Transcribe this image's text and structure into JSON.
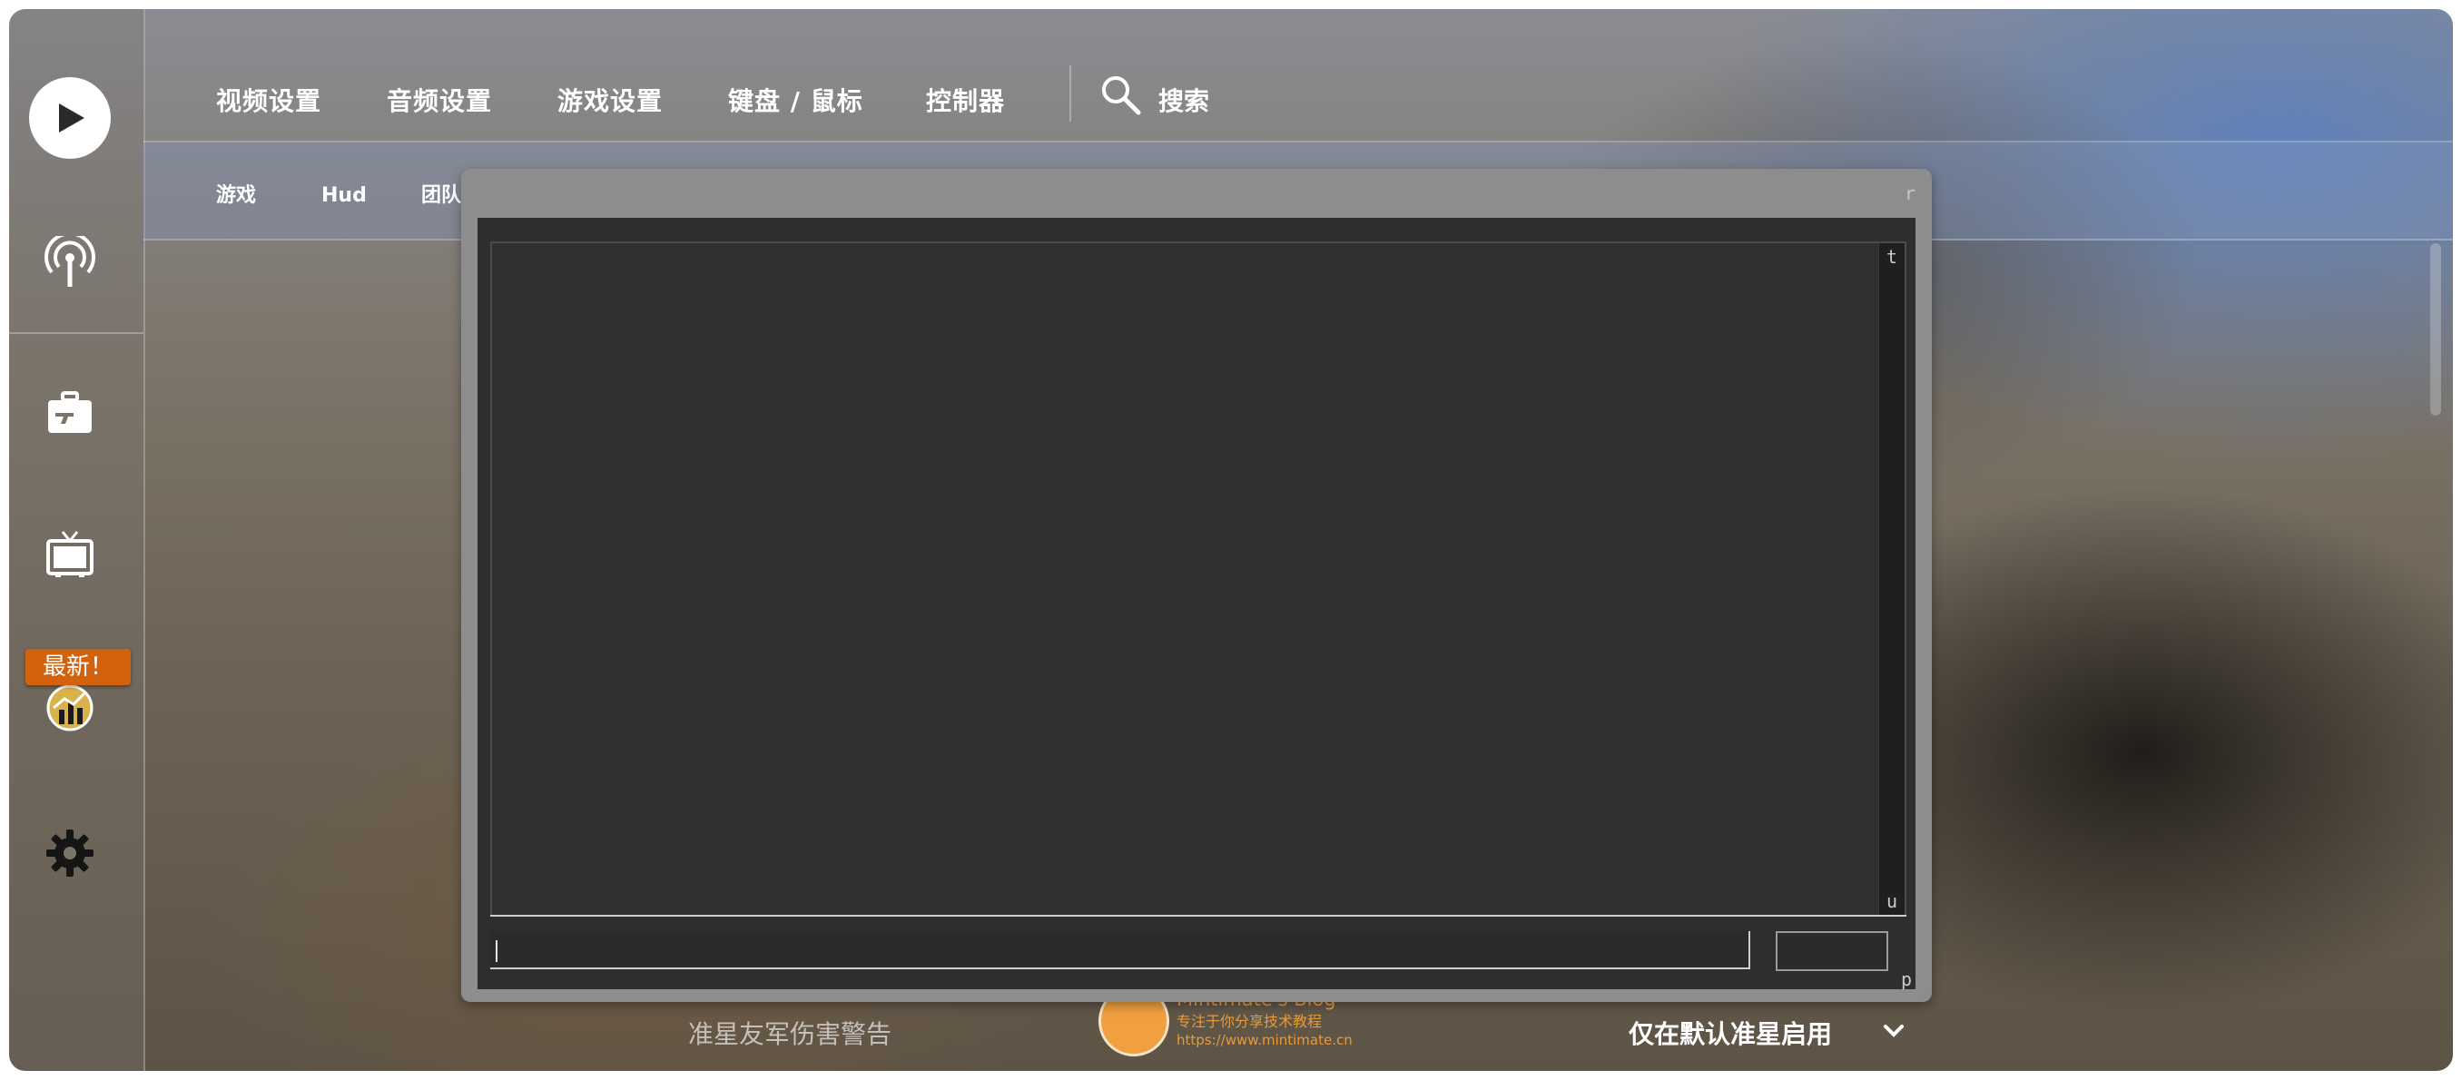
{
  "topnav": {
    "tabs": [
      "视频设置",
      "音频设置",
      "游戏设置",
      "键盘 / 鼠标",
      "控制器"
    ],
    "search_label": "搜索"
  },
  "subnav": {
    "items": [
      "游戏",
      "Hud",
      "团队"
    ]
  },
  "sidebar": {
    "icons": [
      "play-icon",
      "broadcast-icon",
      "briefcase-icon",
      "tv-icon",
      "stats-icon",
      "gear-icon"
    ],
    "new_badge": "最新！"
  },
  "console": {
    "corner_markers": {
      "top_right": "r",
      "scroll_top": "t",
      "scroll_bottom": "u",
      "bottom_right": "p"
    },
    "input_value": ""
  },
  "setting_row": {
    "label": "准星友军伤害警告",
    "value": "仅在默认准星启用"
  },
  "watermark": {
    "title": "Mintimate's Blog",
    "subtitle": "专注于你分享技术教程",
    "url": "https://www.mintimate.cn"
  },
  "colors": {
    "badge": "#d2620e",
    "console_frame": "#8d8d8d",
    "console_panel": "#2e2e2e",
    "watermark": "#e89a3a"
  }
}
